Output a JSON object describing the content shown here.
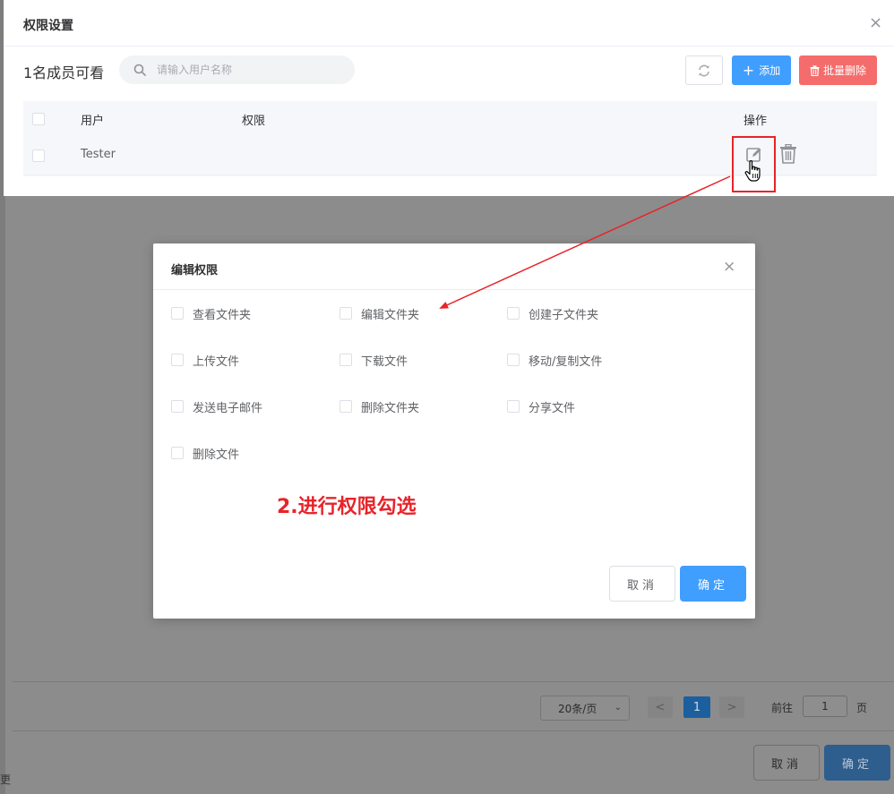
{
  "permission_panel": {
    "title": "权限设置",
    "close_glyph": "×",
    "member_count": "1名成员可看",
    "search": {
      "placeholder": "请输入用户名称",
      "value": ""
    },
    "add_label": "添加",
    "add_glyph": "+",
    "bulk_delete_label": "批量删除",
    "table": {
      "headers": {
        "user": "用户",
        "permission": "权限",
        "actions": "操作"
      },
      "rows": [
        {
          "user": "Tester",
          "permission": ""
        }
      ]
    }
  },
  "edit_dialog": {
    "title": "编辑权限",
    "close_glyph": "×",
    "options": [
      {
        "label": "查看文件夹",
        "checked": false
      },
      {
        "label": "编辑文件夹",
        "checked": false
      },
      {
        "label": "创建子文件夹",
        "checked": false
      },
      {
        "label": "上传文件",
        "checked": false
      },
      {
        "label": "下载文件",
        "checked": false
      },
      {
        "label": "移动/复制文件",
        "checked": false
      },
      {
        "label": "发送电子邮件",
        "checked": false
      },
      {
        "label": "删除文件夹",
        "checked": false
      },
      {
        "label": "分享文件",
        "checked": false
      },
      {
        "label": "删除文件",
        "checked": false
      }
    ],
    "cancel_label": "取消",
    "ok_label": "确定"
  },
  "annotation": {
    "text": "2.进行权限勾选",
    "color": "#e8232a"
  },
  "background": {
    "page_size": "20条/页",
    "current_page": "1",
    "goto_label": "前往",
    "goto_value": "1",
    "page_unit": "页",
    "prev_glyph": "<",
    "next_glyph": ">",
    "cancel_label": "取消",
    "ok_label": "确定",
    "edge_char": "更"
  },
  "colors": {
    "primary": "#409eff",
    "danger": "#f56c6c",
    "highlight": "#e8232a"
  }
}
